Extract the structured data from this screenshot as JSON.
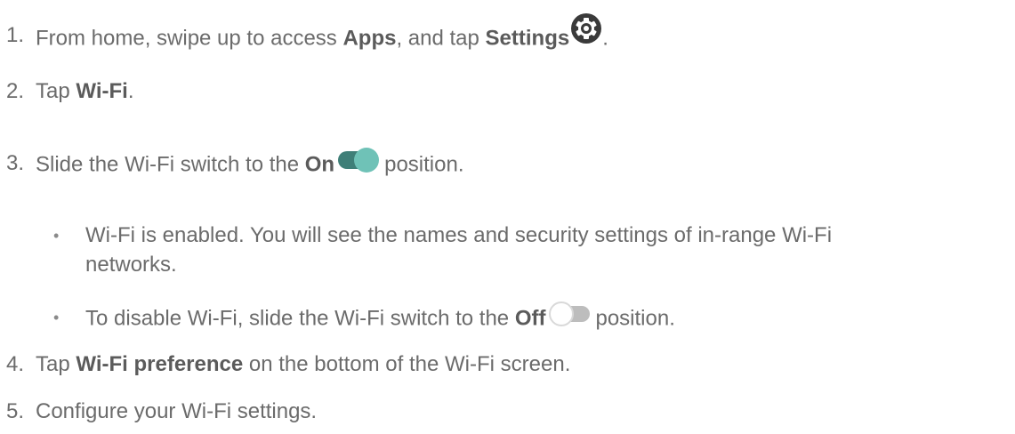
{
  "steps": [
    {
      "num": "1.",
      "pre": "From home, swipe up to access ",
      "bold1": "Apps",
      "mid": ", and tap ",
      "bold2": "Settings",
      "post": "."
    },
    {
      "num": "2.",
      "pre": "Tap ",
      "bold": "Wi-Fi",
      "post": "."
    },
    {
      "num": "3.",
      "pre": "Slide the Wi-Fi switch to the ",
      "bold": "On",
      "post": "position."
    },
    {
      "num": "4.",
      "pre": "Tap ",
      "bold": "Wi-Fi preference",
      "post": " on the bottom of the Wi-Fi screen."
    },
    {
      "num": "5.",
      "text": "Configure your Wi-Fi settings."
    }
  ],
  "bullets": [
    {
      "mark": "•",
      "line1": "Wi-Fi is enabled. You will see the names and security settings of in-range Wi-Fi",
      "line2": "networks."
    },
    {
      "mark": "•",
      "pre": "To disable Wi-Fi, slide the Wi-Fi switch to the ",
      "bold": "Off",
      "post": "position."
    }
  ],
  "icons": {
    "settings": "gear-icon",
    "switch_on": "toggle-on-icon",
    "switch_off": "toggle-off-icon"
  },
  "colors": {
    "text": "#6b6b6b",
    "toggle_on_thumb": "#6fc2b7",
    "toggle_on_track": "#3f7f78",
    "toggle_off_thumb": "#d9d9d9",
    "gear_fill": "#3a3a3a"
  }
}
